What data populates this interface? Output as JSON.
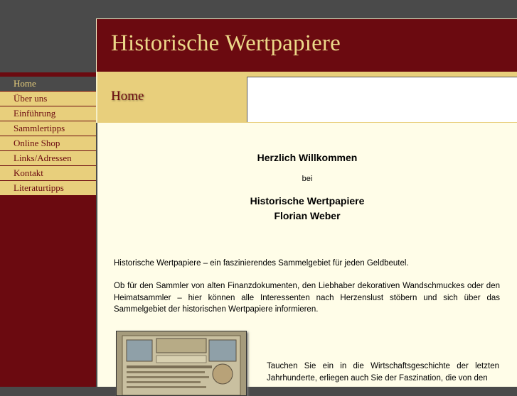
{
  "header": {
    "title": "Historische Wertpapiere"
  },
  "nav": {
    "items": [
      {
        "label": "Home"
      },
      {
        "label": "Über uns"
      },
      {
        "label": "Einführung"
      },
      {
        "label": "Sammlertipps"
      },
      {
        "label": "Online Shop"
      },
      {
        "label": "Links/Adressen"
      },
      {
        "label": "Kontakt"
      },
      {
        "label": "Literaturtipps"
      }
    ]
  },
  "breadcrumb": {
    "title": "Home"
  },
  "main": {
    "welcome": "Herzlich Willkommen",
    "bei": "bei",
    "name_line1": "Historische Wertpapiere",
    "name_line2": "Florian Weber",
    "paragraph1": "Historische Wertpapiere – ein faszinierendes Sammelgebiet für jeden Geldbeutel.",
    "paragraph2": "Ob für den Sammler von alten Finanzdokumenten, den Liebhaber dekorativen Wandschmuckes oder den Heimatsammler – hier können alle Interessenten nach Herzenslust stöbern und sich über das Sammelgebiet der historischen Wertpapiere informieren.",
    "paragraph3": "Tauchen Sie ein in die Wirtschaftsgeschichte der letzten Jahrhunderte, erliegen auch Sie der Faszination, die von den"
  }
}
